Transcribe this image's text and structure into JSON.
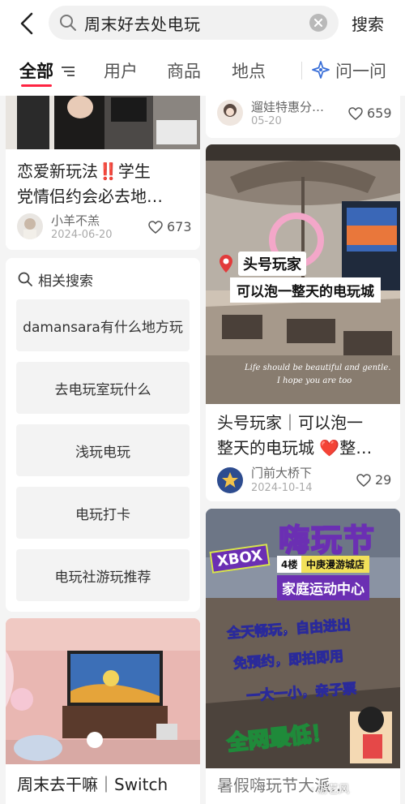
{
  "search": {
    "query": "周末好去处电玩",
    "button": "搜索"
  },
  "tabs": [
    {
      "label": "全部"
    },
    {
      "label": "用户"
    },
    {
      "label": "商品"
    },
    {
      "label": "地点"
    },
    {
      "label": "问一问"
    }
  ],
  "left_column": {
    "card1": {
      "title_line1": "恋爱新玩法‼️学生",
      "title_line2": "党情侣约会必去地…",
      "author": "小羊不羔",
      "date": "2024-06-20",
      "likes": "673"
    },
    "related": {
      "title": "相关搜索",
      "items": [
        "damansara有什么地方玩",
        "去电玩室玩什么",
        "浅玩电玩",
        "电玩打卡",
        "电玩社游玩推荐"
      ]
    },
    "card3": {
      "title_line1": "周末去干嘛｜Switch",
      "title_line2": "…"
    }
  },
  "right_column": {
    "card1": {
      "author": "遛娃特惠分…",
      "date": "05-20",
      "likes": "659"
    },
    "card2": {
      "image_text_tag": "头号玩家",
      "image_text_banner": "可以泡一整天的电玩城",
      "image_caption_line1": "Life should be beautiful and gentle.",
      "image_caption_line2": "I hope you are too",
      "title_line1": "头号玩家｜可以泡一",
      "title_line2": "整天的电玩城 ❤️整…",
      "author": "门前大桥下",
      "date": "2024-10-14",
      "likes": "29"
    },
    "card3": {
      "image_logo": "嗨玩节",
      "image_xbox": "XBOX",
      "image_floor": "4楼",
      "image_store": "中庚漫游城店",
      "image_center": "家庭运动中心",
      "image_line1": "全天畅玩，自由进出",
      "image_line2": "免预约，即拍即用",
      "image_line3": "一大一小，亲子票",
      "image_line4": "全网最低！",
      "title_line1": "暑假嗨玩节大派…"
    }
  },
  "watermark": "· 游艺风",
  "colors": {
    "accent": "#ff2442",
    "like_heart": "#333333"
  }
}
